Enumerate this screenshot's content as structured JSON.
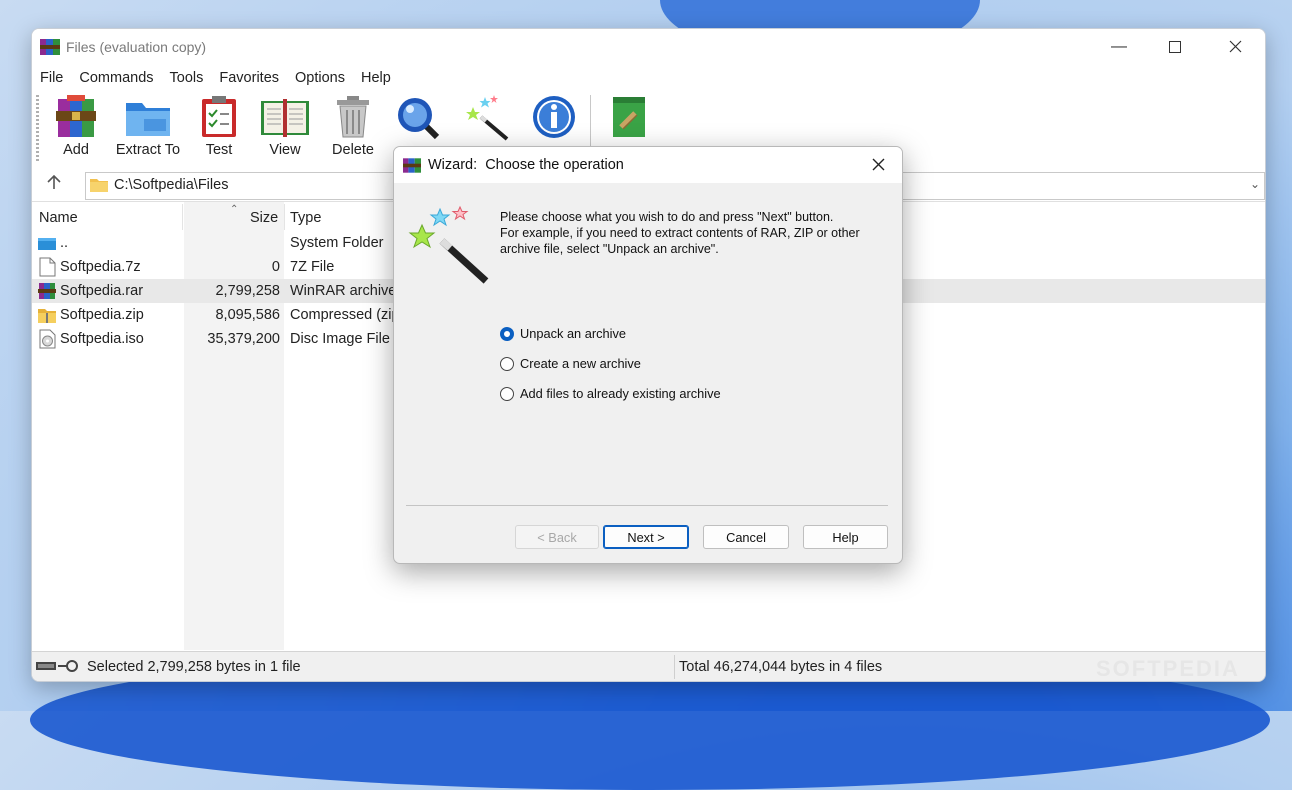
{
  "window": {
    "title": "Files (evaluation copy)",
    "controls": {
      "minimize_icon": "minimize-icon",
      "maximize_icon": "maximize-icon",
      "close_icon": "close-icon"
    }
  },
  "menu": [
    "File",
    "Commands",
    "Tools",
    "Favorites",
    "Options",
    "Help"
  ],
  "toolbar": {
    "buttons": [
      {
        "label": "Add",
        "icon": "add-archive-icon"
      },
      {
        "label": "Extract To",
        "icon": "extract-folder-icon"
      },
      {
        "label": "Test",
        "icon": "test-clipboard-icon"
      },
      {
        "label": "View",
        "icon": "view-book-icon"
      },
      {
        "label": "Delete",
        "icon": "trash-icon"
      },
      {
        "label": "",
        "icon": "find-magnifier-icon"
      },
      {
        "label": "",
        "icon": "wizard-wand-icon"
      },
      {
        "label": "",
        "icon": "info-icon"
      },
      {
        "label": "",
        "icon": "repair-kit-icon"
      }
    ]
  },
  "address": {
    "path": "C:\\Softpedia\\Files"
  },
  "filelist": {
    "columns": {
      "name": "Name",
      "size": "Size",
      "type": "Type"
    },
    "rows": [
      {
        "name": "..",
        "size": "",
        "type": "System Folder",
        "icon": "parent-folder-icon"
      },
      {
        "name": "Softpedia.7z",
        "size": "0",
        "type": "7Z File",
        "icon": "file-icon"
      },
      {
        "name": "Softpedia.rar",
        "size": "2,799,258",
        "type": "WinRAR archive",
        "icon": "rar-archive-icon",
        "selected": true
      },
      {
        "name": "Softpedia.zip",
        "size": "8,095,586",
        "type": "Compressed (zip",
        "icon": "zip-archive-icon"
      },
      {
        "name": "Softpedia.iso",
        "size": "35,379,200",
        "type": "Disc Image File",
        "icon": "disc-image-icon"
      }
    ]
  },
  "status": {
    "left": "Selected 2,799,258 bytes in 1 file",
    "right": "Total 46,274,044 bytes in 4 files",
    "watermark": "SOFTPEDIA"
  },
  "dialog": {
    "title": "Wizard:  Choose the operation",
    "instructions": [
      "Please choose what you wish to do and press \"Next\" button.",
      "For example, if you need to extract contents of RAR, ZIP or other",
      "archive file, select \"Unpack an archive\"."
    ],
    "options": [
      {
        "label": "Unpack an archive",
        "checked": true
      },
      {
        "label": "Create a new archive",
        "checked": false
      },
      {
        "label": "Add files to already existing archive",
        "checked": false
      }
    ],
    "buttons": {
      "back": "< Back",
      "next": "Next >",
      "cancel": "Cancel",
      "help": "Help"
    }
  },
  "colors": {
    "accent": "#0b5fc1",
    "selection_row": "#e8e8e8",
    "size_column_bg": "#f3f3f3"
  }
}
